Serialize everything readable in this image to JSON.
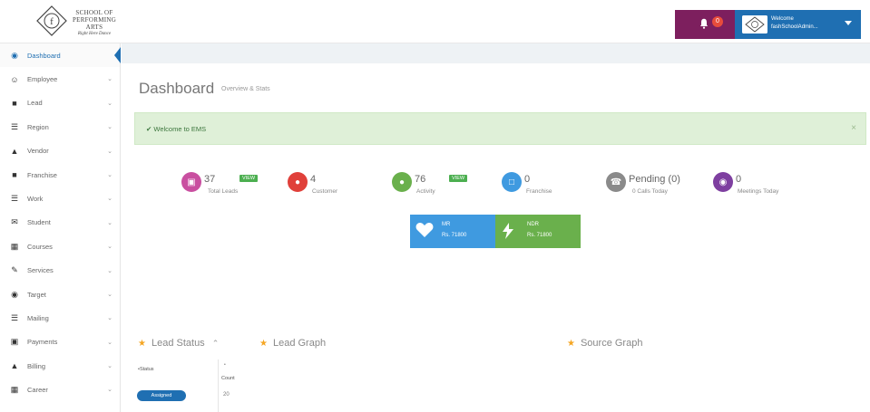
{
  "brand": {
    "line1": "SCHOOL OF",
    "line2": "PERFORMING ARTS",
    "line3": "Right Here Dance"
  },
  "header": {
    "notification_count": "0",
    "user_welcome": "Welcome",
    "user_name": "fashSchoolAdmin..."
  },
  "sidebar": {
    "items": [
      {
        "label": "Dashboard",
        "icon": "dashboard-icon"
      },
      {
        "label": "Employee",
        "icon": "users-icon"
      },
      {
        "label": "Lead",
        "icon": "truck-icon"
      },
      {
        "label": "Region",
        "icon": "list-icon"
      },
      {
        "label": "Vendor",
        "icon": "user-icon"
      },
      {
        "label": "Franchise",
        "icon": "truck-icon"
      },
      {
        "label": "Work",
        "icon": "list-icon"
      },
      {
        "label": "Student",
        "icon": "envelope-icon"
      },
      {
        "label": "Courses",
        "icon": "grid-icon"
      },
      {
        "label": "Services",
        "icon": "pencil-icon"
      },
      {
        "label": "Target",
        "icon": "target-icon"
      },
      {
        "label": "Mailing",
        "icon": "table-icon"
      },
      {
        "label": "Payments",
        "icon": "file-icon"
      },
      {
        "label": "Billing",
        "icon": "warning-icon"
      },
      {
        "label": "Career",
        "icon": "grid-icon"
      }
    ]
  },
  "main": {
    "title": "Dashboard",
    "subtitle": "Overview & Stats",
    "alert": "Welcome to EMS",
    "stats": {
      "total_leads": {
        "value": "37",
        "label": "Total Leads",
        "pill": "VIEW"
      },
      "customer": {
        "value": "4",
        "label": "Customer"
      },
      "activity": {
        "value": "76",
        "label": "Activity",
        "pill": "VIEW"
      },
      "franchise": {
        "value": "0",
        "label": "Franchise"
      },
      "pending": {
        "value": "Pending (0)",
        "label": "0 Calls Today"
      },
      "meetings": {
        "value": "0",
        "label": "Meetings Today"
      }
    },
    "revenue": {
      "mr_label": "MR",
      "mr_value": "Rs. 71800",
      "ndr_label": "NDR",
      "ndr_value": "Rs. 71800"
    },
    "panels": {
      "lead_status": "Lead Status",
      "lead_graph": "Lead Graph",
      "source_graph": "Source Graph"
    },
    "lead_table": {
      "col_status": "Status",
      "col_count": "Count",
      "rows": [
        {
          "status": "Assigned",
          "count": "20"
        }
      ]
    }
  },
  "colors": {
    "primary": "#1f6fb2",
    "notif_bg": "#7d1f5e",
    "alert_bg": "#dff0d8",
    "pink": "#c94fa0",
    "red": "#e0403a",
    "green": "#6ab04c",
    "blue": "#3f9ae0",
    "gray": "#8a8a8a",
    "purple": "#7e3fa0"
  }
}
